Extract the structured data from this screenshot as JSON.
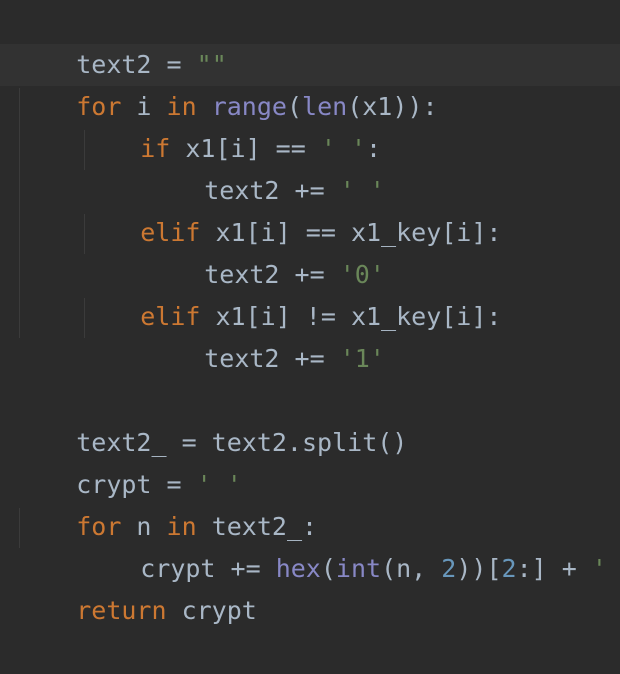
{
  "code": {
    "l1": {
      "a": "text2 = ",
      "b": "\"\""
    },
    "l2": {
      "a": "for",
      "b": " i ",
      "c": "in",
      "d": " ",
      "e": "range",
      "f": "(",
      "g": "len",
      "h": "(x1)):"
    },
    "l3": {
      "a": "if",
      "b": " x1[i] == ",
      "c": "' '",
      "d": ":"
    },
    "l4": {
      "a": "text2 += ",
      "b": "' '"
    },
    "l5": {
      "a": "elif",
      "b": " x1[i] == x1_key[i]:"
    },
    "l6": {
      "a": "text2 += ",
      "b": "'0'"
    },
    "l7": {
      "a": "elif",
      "b": " x1[i] != x1_key[i]:"
    },
    "l8": {
      "a": "text2 += ",
      "b": "'1'"
    },
    "l9": {
      "a": "text2_ = text2.split()"
    },
    "l10": {
      "a": "crypt = ",
      "b": "' '"
    },
    "l11": {
      "a": "for",
      "b": " n ",
      "c": "in",
      "d": " text2_:"
    },
    "l12": {
      "a": "crypt += ",
      "b": "hex",
      "c": "(",
      "d": "int",
      "e": "(n, ",
      "f": "2",
      "g": "))[",
      "h": "2",
      "i": ":] + ",
      "j": "' '"
    },
    "l13": {
      "a": "return",
      "b": " crypt"
    }
  },
  "colors": {
    "background": "#2b2b2b",
    "current_line": "#323232",
    "keyword": "#cc7832",
    "builtin": "#8888c6",
    "string": "#6a8759",
    "number": "#6897bb",
    "identifier": "#a9b7c6"
  }
}
